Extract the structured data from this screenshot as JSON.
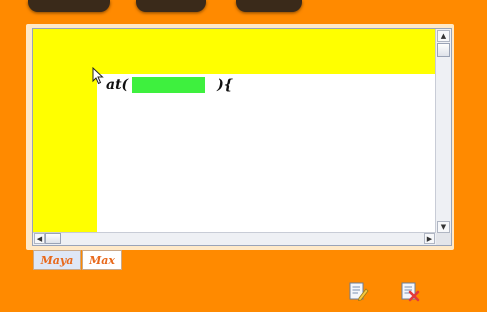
{
  "editor": {
    "code_prefix": "at(",
    "code_suffix": "){"
  },
  "tabs": [
    {
      "label": "Maya",
      "selected": true
    },
    {
      "label": "Max",
      "selected": false
    }
  ],
  "icons": {
    "edit": "edit-document-icon",
    "delete": "delete-document-icon"
  },
  "colors": {
    "background": "#ff8a00",
    "highlight": "#ffff00",
    "blank": "#3ef03e"
  }
}
